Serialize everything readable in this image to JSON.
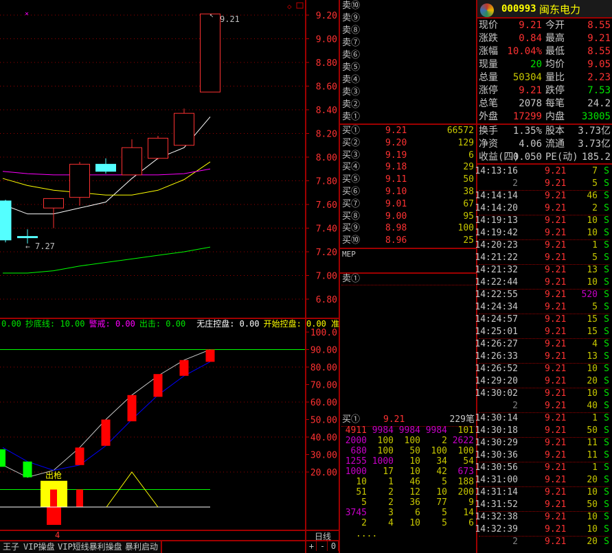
{
  "chart_data": {
    "type": "candlestick",
    "price_axis": {
      "ticks": [
        "9.20",
        "9.00",
        "8.80",
        "8.60",
        "8.40",
        "8.20",
        "8.00",
        "7.80",
        "7.60",
        "7.40",
        "7.20",
        "7.00",
        "6.80"
      ],
      "range": [
        6.8,
        9.2
      ]
    },
    "candles": [
      {
        "o": 7.63,
        "h": 7.64,
        "l": 7.28,
        "c": 7.3
      },
      {
        "o": 7.33,
        "h": 7.39,
        "l": 7.27,
        "c": 7.32
      },
      {
        "o": 7.57,
        "h": 7.65,
        "l": 7.4,
        "c": 7.65
      },
      {
        "o": 7.66,
        "h": 7.96,
        "l": 7.59,
        "c": 7.94
      },
      {
        "o": 7.94,
        "h": 7.99,
        "l": 7.86,
        "c": 7.88
      },
      {
        "o": 7.85,
        "h": 8.15,
        "l": 7.85,
        "c": 8.08
      },
      {
        "o": 7.99,
        "h": 8.18,
        "l": 7.98,
        "c": 8.16
      },
      {
        "o": 8.1,
        "h": 8.41,
        "l": 8.1,
        "c": 8.37
      },
      {
        "o": 8.55,
        "h": 9.21,
        "l": 8.55,
        "c": 9.21
      }
    ],
    "ma_lines": [
      {
        "color": "#ffffff",
        "values": [
          7.6,
          7.52,
          7.52,
          7.57,
          7.62,
          7.82,
          7.99,
          8.08,
          8.34
        ]
      },
      {
        "color": "#ffff00",
        "values": [
          7.82,
          7.76,
          7.72,
          7.7,
          7.68,
          7.68,
          7.72,
          7.81,
          7.96
        ]
      },
      {
        "color": "#ff00ff",
        "values": [
          7.88,
          7.86,
          7.85,
          7.85,
          7.85,
          7.85,
          7.85,
          7.86,
          7.9
        ]
      },
      {
        "color": "#00ff00",
        "values": [
          7.02,
          7.02,
          7.04,
          7.08,
          7.11,
          7.14,
          7.17,
          7.2,
          7.24
        ]
      }
    ],
    "high_label": "9.21",
    "low_label": "7.27",
    "indicator": {
      "ticks": [
        "100.0",
        "90.00",
        "80.00",
        "70.00",
        "60.00",
        "50.00",
        "40.00",
        "30.00",
        "20.00"
      ],
      "range": [
        0,
        100
      ],
      "bars": [
        {
          "lo": 23,
          "hi": 33,
          "color": "#00ff00"
        },
        {
          "lo": 17,
          "hi": 26,
          "color": "#00ff00"
        },
        null,
        {
          "lo": 24,
          "hi": 34,
          "color": "#ff0000"
        },
        {
          "lo": 35,
          "hi": 50,
          "color": "#ff0000"
        },
        {
          "lo": 49,
          "hi": 64,
          "color": "#ff0000"
        },
        {
          "lo": 63,
          "hi": 76,
          "color": "#ff0000"
        },
        {
          "lo": 75,
          "hi": 84,
          "color": "#ff0000"
        },
        {
          "lo": 83,
          "hi": 90,
          "color": "#ff0000"
        }
      ],
      "white_line": [
        24,
        17,
        21,
        34,
        50,
        64,
        75,
        84,
        90
      ],
      "blue_line": [
        34,
        26,
        21,
        24,
        35,
        50,
        64,
        75,
        83
      ],
      "signal_label": "出枪"
    }
  },
  "indicator_legend": [
    {
      "text": "0.00",
      "color": "#00e600"
    },
    {
      "text": "抄底线: 10.00",
      "color": "#00e600"
    },
    {
      "text": "警戒: ",
      "color": "#ff00ff"
    },
    {
      "text": "0.00",
      "color": "#ff00ff"
    },
    {
      "text": "出击: 0.00",
      "color": "#00e600"
    },
    {
      "text": "无庄控盘: 0.00",
      "color": "#ffffff"
    },
    {
      "text": "开始控盘: 0.00 准",
      "color": "#ffff00"
    }
  ],
  "date_marker": "4",
  "period_label": "日线",
  "zoom_buttons": [
    "+",
    "-",
    "0"
  ],
  "tabs": [
    "王子",
    "VIP操盘",
    "VIP短线暴利操盘",
    "暴利启动"
  ],
  "order_book": {
    "sells": [
      "卖⑩",
      "卖⑨",
      "卖⑧",
      "卖⑦",
      "卖⑥",
      "卖⑤",
      "卖④",
      "卖③",
      "卖②",
      "卖①"
    ],
    "buys": [
      {
        "label": "买①",
        "price": "9.21",
        "vol": "66572"
      },
      {
        "label": "买②",
        "price": "9.20",
        "vol": "129"
      },
      {
        "label": "买③",
        "price": "9.19",
        "vol": "6"
      },
      {
        "label": "买④",
        "price": "9.18",
        "vol": "29"
      },
      {
        "label": "买⑤",
        "price": "9.11",
        "vol": "50"
      },
      {
        "label": "买⑥",
        "price": "9.10",
        "vol": "38"
      },
      {
        "label": "买⑦",
        "price": "9.01",
        "vol": "67"
      },
      {
        "label": "买⑧",
        "price": "9.00",
        "vol": "95"
      },
      {
        "label": "买⑨",
        "price": "8.98",
        "vol": "100"
      },
      {
        "label": "买⑩",
        "price": "8.96",
        "vol": "25"
      }
    ],
    "mep": "MEP",
    "sell1_label": "卖①",
    "queue": {
      "label": "买①",
      "price": "9.21",
      "count": "229笔",
      "rows": [
        [
          [
            "4911",
            "r"
          ],
          [
            "9984",
            "m"
          ],
          [
            "9984",
            "m"
          ],
          [
            "9984",
            "m"
          ],
          [
            "101",
            "y"
          ]
        ],
        [
          [
            "2000",
            "m"
          ],
          [
            "100",
            "y"
          ],
          [
            "100",
            "y"
          ],
          [
            "2",
            "y"
          ],
          [
            "2622",
            "m"
          ]
        ],
        [
          [
            "680",
            "m"
          ],
          [
            "100",
            "y"
          ],
          [
            "50",
            "y"
          ],
          [
            "100",
            "y"
          ],
          [
            "100",
            "y"
          ]
        ],
        [
          [
            "1255",
            "m"
          ],
          [
            "1000",
            "m"
          ],
          [
            "10",
            "y"
          ],
          [
            "34",
            "y"
          ],
          [
            "54",
            "y"
          ]
        ],
        [
          [
            "1000",
            "m"
          ],
          [
            "17",
            "y"
          ],
          [
            "10",
            "y"
          ],
          [
            "42",
            "y"
          ],
          [
            "673",
            "m"
          ]
        ],
        [
          [
            "10",
            "y"
          ],
          [
            "1",
            "y"
          ],
          [
            "46",
            "y"
          ],
          [
            "5",
            "y"
          ],
          [
            "188",
            "y"
          ]
        ],
        [
          [
            "51",
            "y"
          ],
          [
            "2",
            "y"
          ],
          [
            "12",
            "y"
          ],
          [
            "10",
            "y"
          ],
          [
            "200",
            "y"
          ]
        ],
        [
          [
            "5",
            "y"
          ],
          [
            "2",
            "y"
          ],
          [
            "36",
            "y"
          ],
          [
            "77",
            "y"
          ],
          [
            "9",
            "y"
          ]
        ],
        [
          [
            "3745",
            "m"
          ],
          [
            "3",
            "y"
          ],
          [
            "6",
            "y"
          ],
          [
            "5",
            "y"
          ],
          [
            "14",
            "y"
          ]
        ],
        [
          [
            "2",
            "y"
          ],
          [
            "4",
            "y"
          ],
          [
            "10",
            "y"
          ],
          [
            "5",
            "y"
          ],
          [
            "6",
            "y"
          ]
        ]
      ],
      "more": "...."
    }
  },
  "quote": {
    "code": "000993",
    "name": "闽东电力",
    "rows": [
      [
        [
          "现价",
          "9.21",
          "r"
        ],
        [
          "今开",
          "8.55",
          "r"
        ]
      ],
      [
        [
          "涨跌",
          "0.84",
          "r"
        ],
        [
          "最高",
          "9.21",
          "r"
        ]
      ],
      [
        [
          "涨幅",
          "10.04%",
          "r"
        ],
        [
          "最低",
          "8.55",
          "r"
        ]
      ],
      [
        [
          "现量",
          "20",
          "g"
        ],
        [
          "均价",
          "9.05",
          "r"
        ]
      ],
      [
        [
          "总量",
          "50304",
          "y"
        ],
        [
          "量比",
          "2.23",
          "r"
        ]
      ],
      [
        [
          "涨停",
          "9.21",
          "r"
        ],
        [
          "跌停",
          "7.53",
          "g"
        ]
      ],
      [
        [
          "总笔",
          "2078",
          "w"
        ],
        [
          "每笔",
          "24.2",
          "w"
        ]
      ],
      [
        [
          "外盘",
          "17299",
          "r"
        ],
        [
          "内盘",
          "33005",
          "g"
        ]
      ]
    ],
    "rows2": [
      [
        [
          "换手",
          "1.35%",
          "w"
        ],
        [
          "股本",
          "3.73亿",
          "w"
        ]
      ],
      [
        [
          "净资",
          "4.06",
          "w"
        ],
        [
          "流通",
          "3.73亿",
          "w"
        ]
      ],
      [
        [
          "收益(四)",
          "0.050",
          "w"
        ],
        [
          "PE(动)",
          "185.2",
          "w"
        ]
      ]
    ]
  },
  "trades": [
    [
      "14:13:16",
      "9.21",
      "7",
      "y"
    ],
    [
      "2",
      "9.21",
      "5",
      "y"
    ],
    [
      "14:14:14",
      "9.21",
      "46",
      "y"
    ],
    [
      "14:14:20",
      "9.21",
      "2",
      "y"
    ],
    [
      "14:19:13",
      "9.21",
      "10",
      "y"
    ],
    [
      "14:19:42",
      "9.21",
      "10",
      "y"
    ],
    [
      "14:20:23",
      "9.21",
      "1",
      "y"
    ],
    [
      "14:21:22",
      "9.21",
      "5",
      "y"
    ],
    [
      "14:21:32",
      "9.21",
      "13",
      "y"
    ],
    [
      "14:22:44",
      "9.21",
      "10",
      "y"
    ],
    [
      "14:22:55",
      "9.21",
      "520",
      "m"
    ],
    [
      "14:24:34",
      "9.21",
      "5",
      "y"
    ],
    [
      "14:24:57",
      "9.21",
      "15",
      "y"
    ],
    [
      "14:25:01",
      "9.21",
      "15",
      "y"
    ],
    [
      "14:26:27",
      "9.21",
      "4",
      "y"
    ],
    [
      "14:26:33",
      "9.21",
      "13",
      "y"
    ],
    [
      "14:26:52",
      "9.21",
      "10",
      "y"
    ],
    [
      "14:29:20",
      "9.21",
      "20",
      "y"
    ],
    [
      "14:30:02",
      "9.21",
      "10",
      "y"
    ],
    [
      "2",
      "9.21",
      "40",
      "y"
    ],
    [
      "14:30:14",
      "9.21",
      "1",
      "y"
    ],
    [
      "14:30:18",
      "9.21",
      "50",
      "y"
    ],
    [
      "14:30:29",
      "9.21",
      "11",
      "y"
    ],
    [
      "14:30:36",
      "9.21",
      "11",
      "y"
    ],
    [
      "14:30:56",
      "9.21",
      "1",
      "y"
    ],
    [
      "14:31:00",
      "9.21",
      "20",
      "y"
    ],
    [
      "14:31:14",
      "9.21",
      "10",
      "y"
    ],
    [
      "14:31:52",
      "9.21",
      "50",
      "y"
    ],
    [
      "14:32:38",
      "9.21",
      "10",
      "y"
    ],
    [
      "14:32:39",
      "9.21",
      "10",
      "y"
    ],
    [
      "2",
      "9.21",
      "20",
      "y"
    ]
  ],
  "trade_side": "S"
}
